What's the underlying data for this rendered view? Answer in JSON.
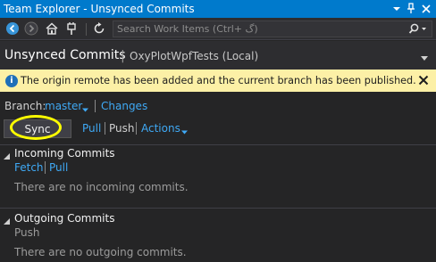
{
  "window": {
    "title": "Team Explorer - Unsynced Commits",
    "pin_icon": "pin-icon",
    "close_icon": "close-icon"
  },
  "toolbar": {
    "icons": [
      "back-icon",
      "forward-icon",
      "home-icon",
      "connect-icon",
      "refresh-icon"
    ],
    "search_placeholder": "Search Work Items (Ctrl+ گ)"
  },
  "header": {
    "title": "Unsynced Commits",
    "separator": "|",
    "subtitle": "OxyPlotWpfTests (Local)"
  },
  "info_bar": {
    "message": "The origin remote has been added and the current branch has been published.",
    "background": "#fcf0a6"
  },
  "branch": {
    "label": "Branch:",
    "current": "master",
    "separator": "|",
    "changes_link": "Changes"
  },
  "actions": {
    "sync_label": "Sync",
    "pull_label": "Pull",
    "separator": "|",
    "push_label": "Push",
    "actions_label": "Actions"
  },
  "incoming": {
    "title": "Incoming Commits",
    "fetch_label": "Fetch",
    "separator": "|",
    "pull_label": "Pull",
    "empty_message": "There are no incoming commits."
  },
  "outgoing": {
    "title": "Outgoing Commits",
    "push_label": "Push",
    "empty_message": "There are no outgoing commits."
  },
  "colors": {
    "accent": "#007acc",
    "link": "#3fa9f5",
    "highlight_ring": "#ffff00"
  }
}
